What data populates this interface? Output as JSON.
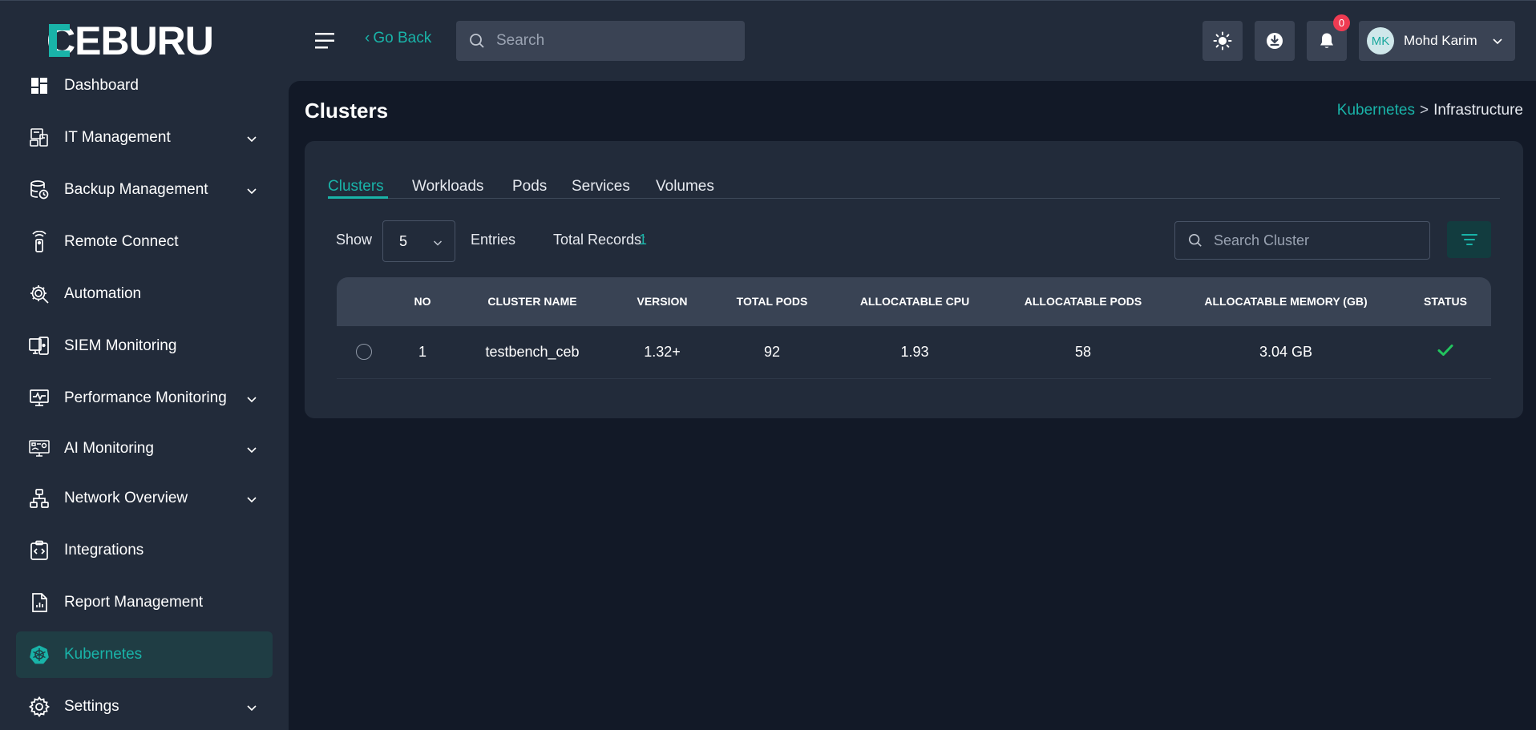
{
  "brand": {
    "logo_text": "CEBURU"
  },
  "header": {
    "go_back": "Go Back",
    "search_placeholder": "Search",
    "notifications_count": "0",
    "user": {
      "initials": "MK",
      "name": "Mohd Karim"
    }
  },
  "sidebar": {
    "items": [
      {
        "label": "Dashboard"
      },
      {
        "label": "IT Management"
      },
      {
        "label": "Backup Management"
      },
      {
        "label": "Remote Connect"
      },
      {
        "label": "Automation"
      },
      {
        "label": "SIEM Monitoring"
      },
      {
        "label": "Performance Monitoring"
      },
      {
        "label": "AI Monitoring"
      },
      {
        "label": "Network Overview"
      },
      {
        "label": "Integrations"
      },
      {
        "label": "Report Management"
      },
      {
        "label": "Kubernetes"
      },
      {
        "label": "Settings"
      }
    ]
  },
  "page": {
    "title": "Clusters",
    "breadcrumb": {
      "parent": "Kubernetes",
      "separator": ">",
      "current": "Infrastructure"
    }
  },
  "tabs": [
    {
      "label": "Clusters"
    },
    {
      "label": "Workloads"
    },
    {
      "label": "Pods"
    },
    {
      "label": "Services"
    },
    {
      "label": "Volumes"
    }
  ],
  "controls": {
    "show_label": "Show",
    "entries_value": "5",
    "entries_label": "Entries",
    "total_records_label": "Total Records:",
    "total_records_value": "1",
    "search_placeholder": "Search Cluster"
  },
  "table": {
    "columns": [
      "NO",
      "CLUSTER NAME",
      "VERSION",
      "TOTAL PODS",
      "ALLOCATABLE CPU",
      "ALLOCATABLE PODS",
      "ALLOCATABLE MEMORY (GB)",
      "STATUS"
    ],
    "rows": [
      {
        "no": "1",
        "cluster_name": "testbench_ceb",
        "version": "1.32+",
        "total_pods": "92",
        "allocatable_cpu": "1.93",
        "allocatable_pods": "58",
        "allocatable_memory": "3.04 GB",
        "status": "check-icon"
      }
    ]
  },
  "colors": {
    "accent": "#19b3a8",
    "badge": "#ef3b52",
    "status_ok": "#22c55e"
  }
}
